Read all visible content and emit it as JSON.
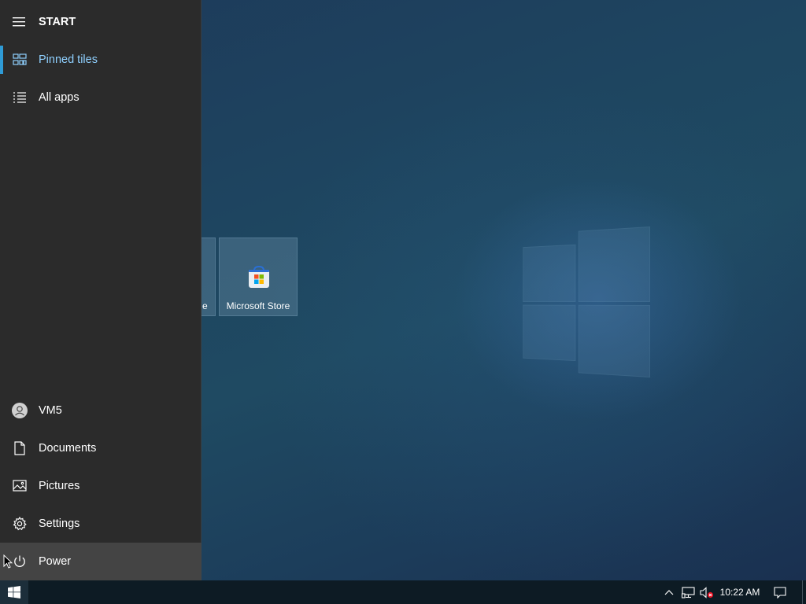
{
  "start_menu": {
    "header": {
      "label": "START",
      "icon": "hamburger-menu-icon"
    },
    "top_items": [
      {
        "label": "Pinned tiles",
        "icon": "tiles-icon",
        "active": true
      },
      {
        "label": "All apps",
        "icon": "list-icon",
        "active": false
      }
    ],
    "bottom_items": [
      {
        "label": "VM5",
        "icon": "user-avatar-icon"
      },
      {
        "label": "Documents",
        "icon": "document-icon"
      },
      {
        "label": "Pictures",
        "icon": "pictures-icon"
      },
      {
        "label": "Settings",
        "icon": "gear-icon"
      },
      {
        "label": "Power",
        "icon": "power-icon",
        "hovered": true
      }
    ]
  },
  "tiles": [
    {
      "label": "e",
      "partially_visible": true
    },
    {
      "label": "Microsoft Store",
      "icon": "microsoft-store-icon"
    }
  ],
  "taskbar": {
    "start_icon": "windows-logo-icon",
    "tray_icons": [
      "chevron-up-icon",
      "network-icon",
      "volume-muted-icon"
    ],
    "clock": "10:22 AM",
    "notification_icon": "action-center-icon"
  },
  "colors": {
    "start_pane": "#2b2b2b",
    "accent": "#2f9bd6",
    "active_text": "#8fd0ff",
    "taskbar": "#0d1b24",
    "hover": "#444444"
  }
}
